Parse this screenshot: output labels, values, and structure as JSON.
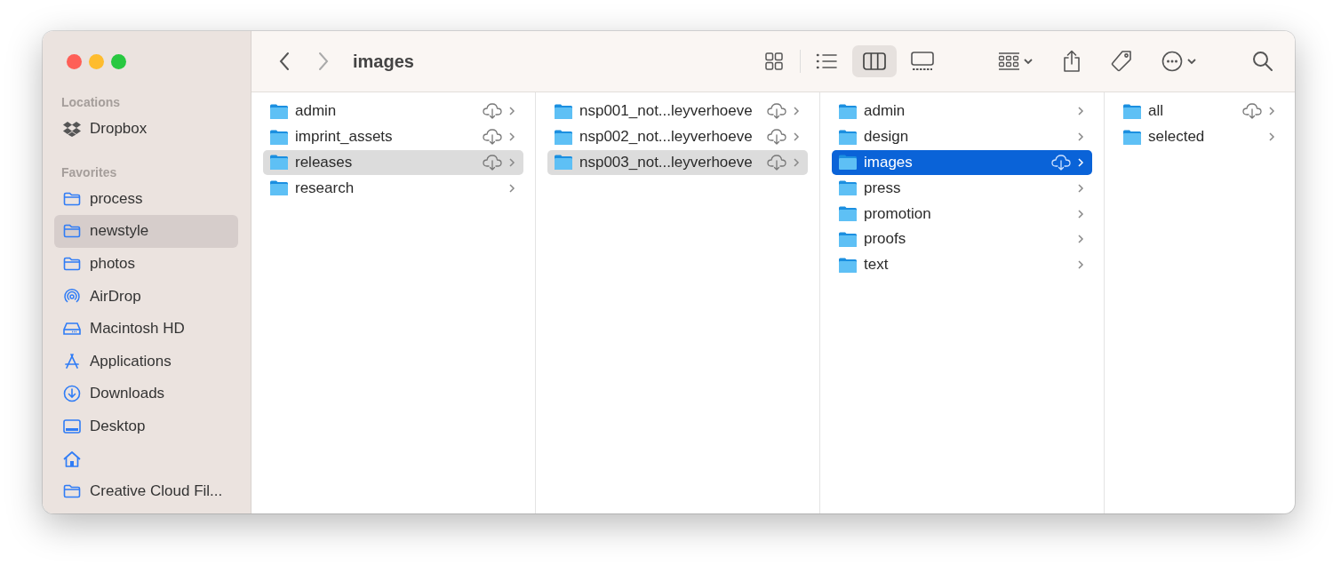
{
  "window": {
    "title": "images"
  },
  "sidebar": {
    "sections": [
      {
        "heading": "Locations",
        "items": [
          {
            "kind": "dropbox",
            "label": "Dropbox",
            "selected": false
          }
        ]
      },
      {
        "heading": "Favorites",
        "items": [
          {
            "kind": "folder",
            "label": "process",
            "selected": false
          },
          {
            "kind": "folder",
            "label": "newstyle",
            "selected": true
          },
          {
            "kind": "folder",
            "label": "photos",
            "selected": false
          },
          {
            "kind": "airdrop",
            "label": "AirDrop",
            "selected": false
          },
          {
            "kind": "disk",
            "label": "Macintosh HD",
            "selected": false
          },
          {
            "kind": "apps",
            "label": "Applications",
            "selected": false
          },
          {
            "kind": "downloads",
            "label": "Downloads",
            "selected": false
          },
          {
            "kind": "desktop",
            "label": "Desktop",
            "selected": false
          },
          {
            "kind": "home",
            "selected": false
          },
          {
            "kind": "folder",
            "label": "Creative Cloud Fil...",
            "selected": false
          }
        ]
      }
    ]
  },
  "view_modes": [
    {
      "kind": "icons",
      "selected": false
    },
    {
      "kind": "list",
      "selected": false
    },
    {
      "kind": "columns",
      "selected": true
    },
    {
      "kind": "gallery",
      "selected": false
    }
  ],
  "columns": [
    {
      "focused": false,
      "items": [
        {
          "name": "admin",
          "cloud": true,
          "selected": false
        },
        {
          "name": "imprint_assets",
          "cloud": true,
          "selected": false
        },
        {
          "name": "releases",
          "cloud": true,
          "selected": true
        },
        {
          "name": "research",
          "cloud": false,
          "selected": false
        }
      ]
    },
    {
      "focused": false,
      "items": [
        {
          "name": "nsp001_not...leyverhoeve",
          "cloud": true,
          "selected": false
        },
        {
          "name": "nsp002_not...leyverhoeve",
          "cloud": true,
          "selected": false
        },
        {
          "name": "nsp003_not...leyverhoeve",
          "cloud": true,
          "selected": true
        }
      ]
    },
    {
      "focused": true,
      "items": [
        {
          "name": "admin",
          "cloud": false,
          "selected": false
        },
        {
          "name": "design",
          "cloud": false,
          "selected": false
        },
        {
          "name": "images",
          "cloud": true,
          "selected": true
        },
        {
          "name": "press",
          "cloud": false,
          "selected": false
        },
        {
          "name": "promotion",
          "cloud": false,
          "selected": false
        },
        {
          "name": "proofs",
          "cloud": false,
          "selected": false
        },
        {
          "name": "text",
          "cloud": false,
          "selected": false
        }
      ]
    },
    {
      "items": [
        {
          "name": "all",
          "cloud": true,
          "selected": false
        },
        {
          "name": "selected",
          "cloud": false,
          "selected": false
        }
      ]
    }
  ]
}
